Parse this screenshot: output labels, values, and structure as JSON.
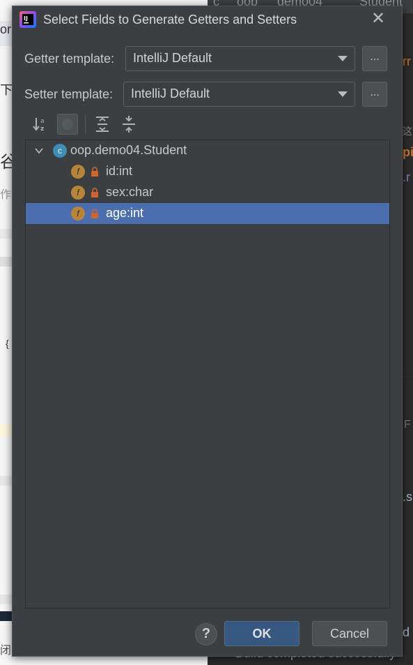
{
  "background": {
    "left_fragments": [
      "or",
      "下",
      "谷",
      "作",
      "{",
      "闭"
    ],
    "right_fragments": [
      "c",
      "oop",
      "demo04",
      "Student",
      "rr",
      "这个",
      "pi",
      ".r",
      "F",
      ".s",
      "d",
      "Build completed successfully"
    ]
  },
  "dialog": {
    "title": "Select Fields to Generate Getters and Setters",
    "close_symbol": "✕",
    "getter": {
      "label": "Getter template:",
      "value": "IntelliJ Default",
      "more": "..."
    },
    "setter": {
      "label": "Setter template:",
      "value": "IntelliJ Default",
      "more": "..."
    },
    "toolbar": [
      "sort-alphabetically-icon",
      "show-inherited-icon",
      "expand-all-icon",
      "collapse-all-icon"
    ],
    "tree": {
      "root": {
        "icon_letter": "c",
        "label": "oop.demo04.Student"
      },
      "fields": [
        {
          "icon_letter": "f",
          "label": "id:int",
          "selected": false
        },
        {
          "icon_letter": "f",
          "label": "sex:char",
          "selected": false
        },
        {
          "icon_letter": "f",
          "label": "age:int",
          "selected": true
        }
      ]
    },
    "buttons": {
      "help": "?",
      "ok": "OK",
      "cancel": "Cancel"
    }
  },
  "colors": {
    "dialog_bg": "#3c3f41",
    "selection": "#4b6eaf",
    "ok_button": "#365880",
    "class_icon": "#3d8eb5",
    "field_icon": "#b5853c",
    "lock": "#d0642e"
  }
}
